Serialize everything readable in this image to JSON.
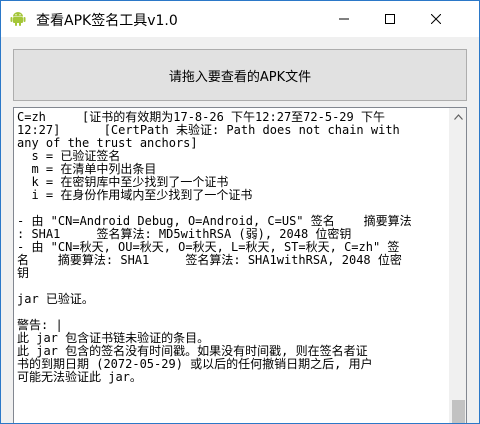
{
  "window": {
    "title": "查看APK签名工具v1.0",
    "app_icon": "android-icon",
    "controls": [
      "minimize-icon",
      "maximize-icon",
      "close-icon"
    ]
  },
  "drop_button": {
    "label": "请拖入要查看的APK文件"
  },
  "output": {
    "lines": [
      "C=zh     [证书的有效期为17-8-26 下午12:27至72-5-29 下午",
      "12:27]      [CertPath 未验证: Path does not chain with",
      "any of the trust anchors]",
      "  s = 已验证签名",
      "  m = 在清单中列出条目",
      "  k = 在密钥库中至少找到了一个证书",
      "  i = 在身份作用域内至少找到了一个证书",
      "",
      "- 由 \"CN=Android Debug, O=Android, C=US\" 签名    摘要算法",
      ": SHA1     签名算法: MD5withRSA (弱), 2048 位密钥",
      "- 由 \"CN=秋天, OU=秋天, O=秋天, L=秋天, ST=秋天, C=zh\" 签",
      "名    摘要算法: SHA1     签名算法: SHA1withRSA, 2048 位密",
      "钥",
      "",
      "jar 已验证。",
      "",
      "警告: |",
      "此 jar 包含证书链未验证的条目。",
      "此 jar 包含的签名没有时间戳。如果没有时间戳, 则在签名者证",
      "书的到期日期 (2072-05-29) 或以后的任何撤销日期之后, 用户",
      "可能无法验证此 jar。"
    ]
  },
  "colors": {
    "window_border": "#2b78c8",
    "button_bg": "#e1e1e1",
    "button_border": "#adadad",
    "android_green": "#a4c639"
  }
}
